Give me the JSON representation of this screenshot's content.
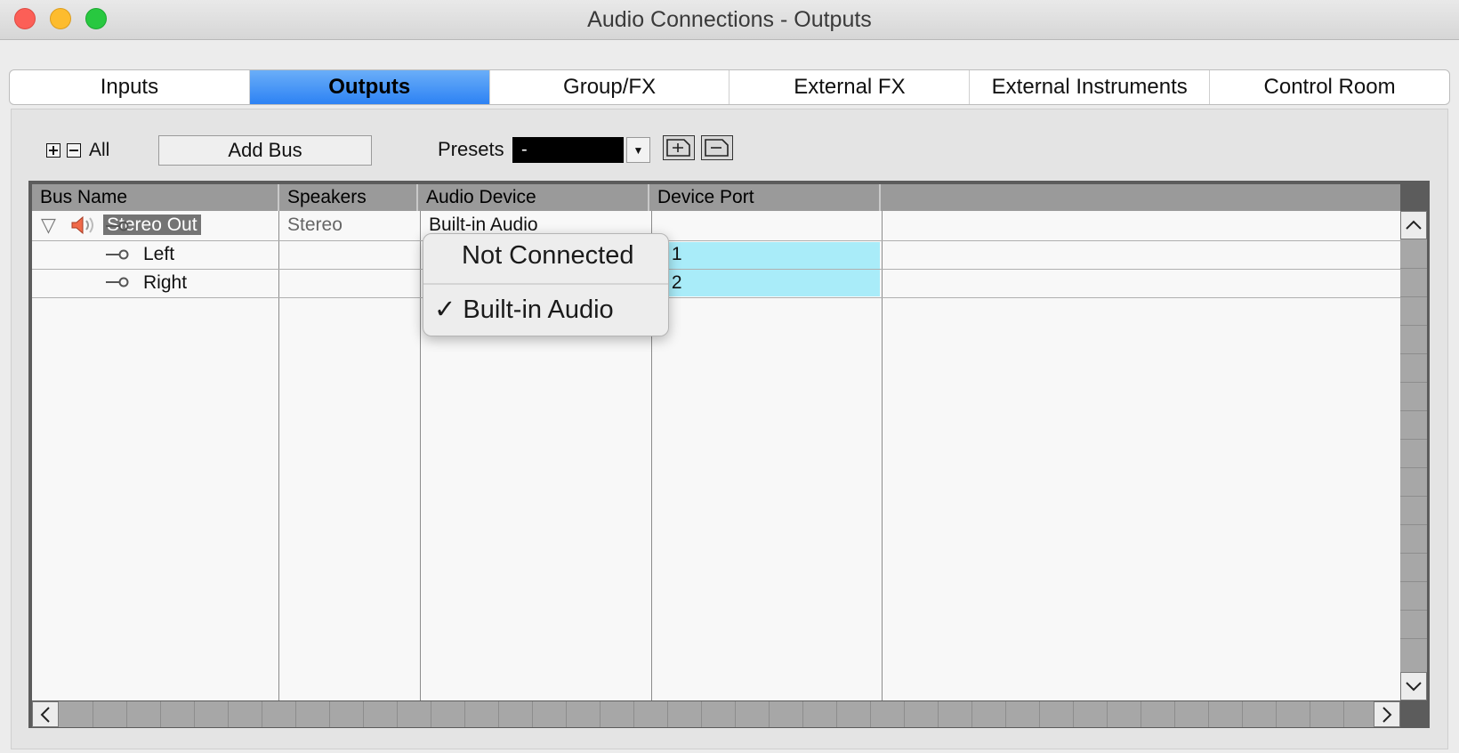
{
  "window": {
    "title": "Audio Connections - Outputs"
  },
  "tabs": [
    {
      "label": "Inputs",
      "active": false
    },
    {
      "label": "Outputs",
      "active": true
    },
    {
      "label": "Group/FX",
      "active": false
    },
    {
      "label": "External FX",
      "active": false
    },
    {
      "label": "External Instruments",
      "active": false
    },
    {
      "label": "Control Room",
      "active": false
    }
  ],
  "toolbar": {
    "all_label": "All",
    "add_bus_label": "Add Bus",
    "presets_label": "Presets",
    "presets_value": "-"
  },
  "table": {
    "columns": [
      "Bus Name",
      "Speakers",
      "Audio Device",
      "Device Port",
      ""
    ],
    "rows": [
      {
        "name": "Stereo Out",
        "speakers": "Stereo",
        "device": "Built-in Audio",
        "port": "",
        "expanded": true
      },
      {
        "name": "Left",
        "speakers": "",
        "device": "",
        "port": "- 1"
      },
      {
        "name": "Right",
        "speakers": "",
        "device": "",
        "port": "- 2"
      }
    ]
  },
  "context_menu": {
    "items": [
      {
        "label": "Not Connected",
        "checked": false
      },
      {
        "label": "Built-in Audio",
        "checked": true,
        "check_mark": "✓"
      }
    ]
  },
  "colors": {
    "active_tab": "#2d82f4",
    "selected_port_cell": "#a9ecf9",
    "presets_field": "#000000"
  },
  "icons": [
    "expand-all-icon",
    "collapse-all-icon",
    "disclosure-triangle-icon",
    "speaker-icon",
    "output-port-icon",
    "add-preset-icon",
    "remove-preset-icon",
    "scroll-up-icon",
    "scroll-down-icon",
    "scroll-left-icon",
    "scroll-right-icon"
  ]
}
